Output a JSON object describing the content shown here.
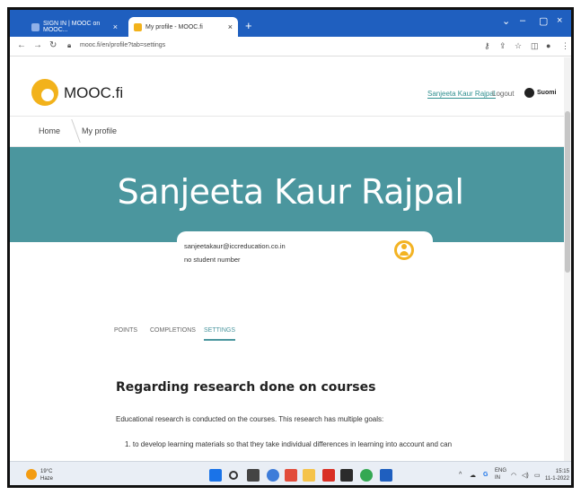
{
  "browser": {
    "tabs": [
      {
        "title": "SIGN IN | MOOC on MOOC...",
        "active": false
      },
      {
        "title": "My profile - MOOC.fi",
        "active": true
      }
    ],
    "url": "mooc.fi/en/profile?tab=settings"
  },
  "header": {
    "brand": "MOOC.fi",
    "user_link": "Sanjeeta Kaur Rajpal",
    "logout": "Logout",
    "language": "Suomi"
  },
  "breadcrumb": {
    "home": "Home",
    "current": "My profile"
  },
  "profile": {
    "name": "Sanjeeta Kaur Rajpal",
    "email": "sanjeetakaur@iccreducation.co.in",
    "student_number": "no student number"
  },
  "profile_tabs": [
    {
      "label": "POINTS",
      "active": false
    },
    {
      "label": "COMPLETIONS",
      "active": false
    },
    {
      "label": "SETTINGS",
      "active": true
    }
  ],
  "research": {
    "title": "Regarding research done on courses",
    "intro": "Educational research is conducted on the courses. This research has multiple goals:",
    "goal_1": "1. to develop learning materials so that they take individual differences in learning into account and can"
  },
  "taskbar": {
    "temperature": "19°C",
    "weather": "Haze",
    "lang_top": "ENG",
    "lang_bottom": "IN",
    "time": "15:15",
    "date": "11-1-2022"
  },
  "colors": {
    "accent": "#4b969e",
    "logo": "#f2b21b",
    "browser_bar": "#1f5fbf"
  }
}
